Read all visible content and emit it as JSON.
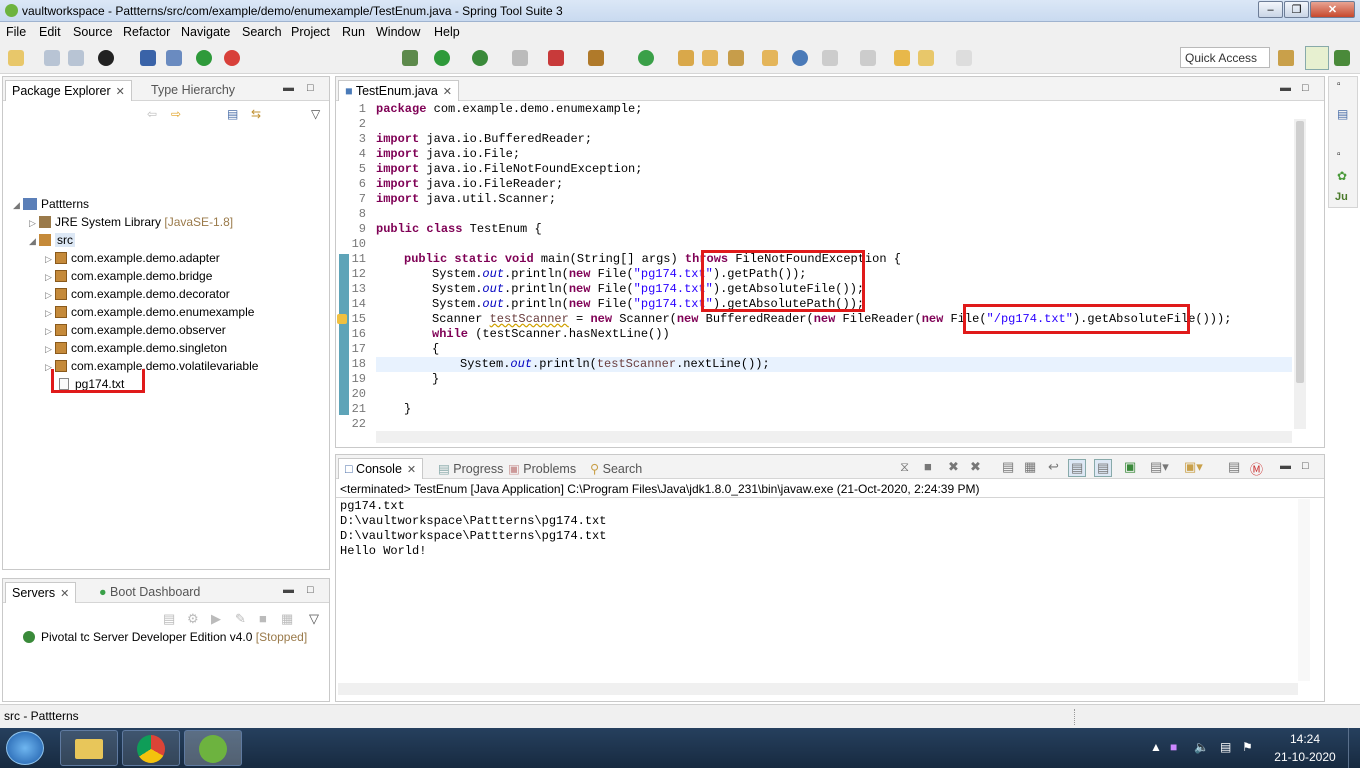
{
  "window": {
    "title": "vaultworkspace - Pattterns/src/com/example/demo/enumexample/TestEnum.java - Spring Tool Suite 3"
  },
  "menu": [
    "File",
    "Edit",
    "Source",
    "Refactor",
    "Navigate",
    "Search",
    "Project",
    "Run",
    "Window",
    "Help"
  ],
  "quick_access": "Quick Access",
  "package_explorer": {
    "tab_label": "Package Explorer",
    "tab2_label": "Type Hierarchy",
    "project": "Pattterns",
    "jre": "JRE System Library",
    "jre_version": "[JavaSE-1.8]",
    "src": "src",
    "packages": [
      "com.example.demo.adapter",
      "com.example.demo.bridge",
      "com.example.demo.decorator",
      "com.example.demo.enumexample",
      "com.example.demo.observer",
      "com.example.demo.singleton",
      "com.example.demo.volatilevariable"
    ],
    "file": "pg174.txt"
  },
  "servers": {
    "tab_label": "Servers",
    "tab2_label": "Boot Dashboard",
    "server": "Pivotal tc Server Developer Edition v4.0",
    "status": "[Stopped]"
  },
  "editor": {
    "tab_label": "TestEnum.java",
    "line_numbers": [
      "1",
      "2",
      "3",
      "4",
      "5",
      "6",
      "7",
      "8",
      "9",
      "10",
      "11",
      "12",
      "13",
      "14",
      "15",
      "16",
      "17",
      "18",
      "19",
      "20",
      "21",
      "22"
    ],
    "l1_pkg": "com.example.demo.enumexample;",
    "imports": [
      "java.io.BufferedReader;",
      "java.io.File;",
      "java.io.FileNotFoundException;",
      "java.io.FileReader;",
      "java.util.Scanner;"
    ],
    "class_name": "TestEnum {",
    "main_sig": "main(String[] args) ",
    "main_exc": "FileNotFoundException {",
    "println_prefix": "System.",
    "out": "out",
    "println_mid": ".println(",
    "new_file": "File(",
    "file_str": "\"pg174.txt\"",
    "get_path": ").getPath());",
    "get_abs_file": ").getAbsoluteFile());",
    "get_abs_path": ").getAbsolutePath());",
    "scanner_type": "Scanner ",
    "scanner_var": "testScanner",
    "scanner_rest_a": " = ",
    "scanner_rest_b": " Scanner(",
    "scanner_rest_c": " BufferedReader(",
    "scanner_rest_d": " FileReader(",
    "scanner_rest_e": " File(",
    "scanner_str": "\"/pg174.txt\"",
    "scanner_end": ").getAbsoluteFile()));",
    "while_rest": " (testScanner.hasNextLine())",
    "brace_open": "{",
    "loop_body_a": "System.",
    "loop_body_b": ".println(",
    "loop_body_c": ".nextLine());",
    "brace_close": "}"
  },
  "console": {
    "tab_label": "Console",
    "progress": "Progress",
    "problems": "Problems",
    "search": "Search",
    "terminated": "<terminated> TestEnum [Java Application] C:\\Program Files\\Java\\jdk1.8.0_231\\bin\\javaw.exe (21-Oct-2020, 2:24:39 PM)",
    "output": [
      "pg174.txt",
      "D:\\vaultworkspace\\Pattterns\\pg174.txt",
      "D:\\vaultworkspace\\Pattterns\\pg174.txt",
      "Hello World!"
    ]
  },
  "status": {
    "text": "src - Pattterns"
  },
  "taskbar": {
    "time": "14:24",
    "date": "21-10-2020"
  },
  "colors": {
    "keyword": "#7f0055",
    "string": "#2a00ff",
    "highlight_box": "#e01a1a"
  }
}
